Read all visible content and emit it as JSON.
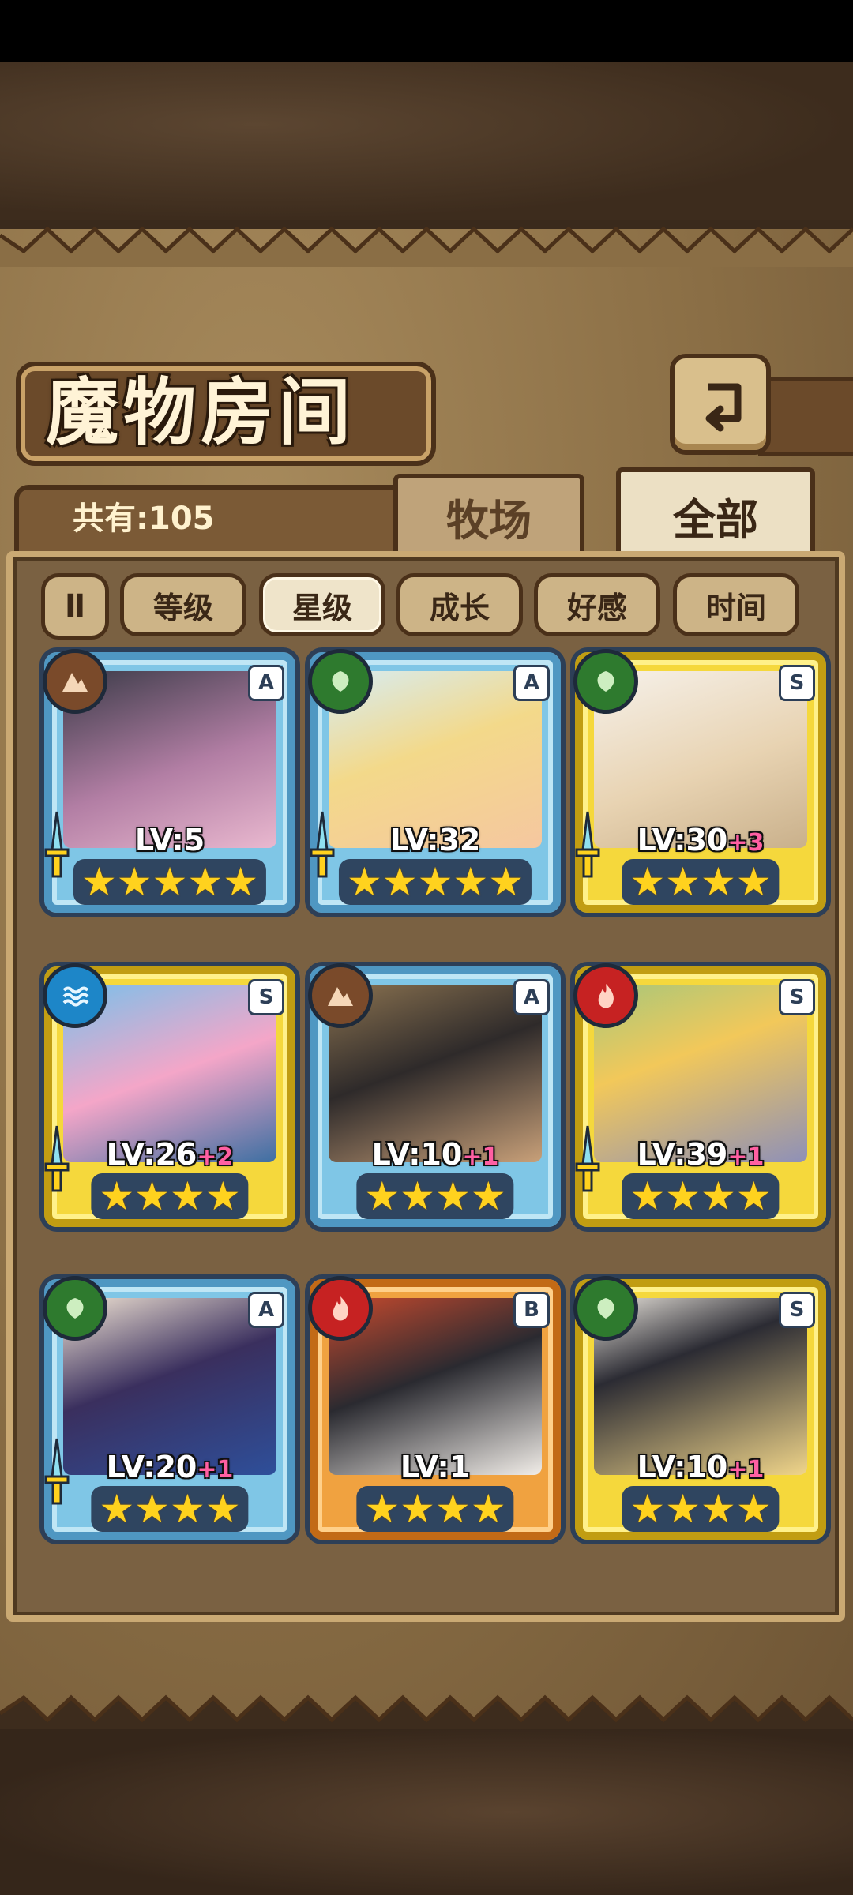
{
  "header": {
    "title": "魔物房间"
  },
  "collection": {
    "count_label": "共有:105"
  },
  "tabs": [
    {
      "label": "牧场"
    },
    {
      "label": "全部"
    }
  ],
  "filters": {
    "sort_toggle": "Ⅱ",
    "items": [
      {
        "label": "等级"
      },
      {
        "label": "星级"
      },
      {
        "label": "成长"
      },
      {
        "label": "好感"
      },
      {
        "label": "时间"
      }
    ],
    "active": "星级"
  },
  "cards": [
    {
      "rank": "A",
      "element": "earth",
      "level": "LV:5",
      "bonus": "",
      "stars": "★★★★★"
    },
    {
      "rank": "A",
      "element": "wood",
      "level": "LV:32",
      "bonus": "",
      "stars": "★★★★★"
    },
    {
      "rank": "S",
      "element": "wood",
      "level": "LV:30",
      "bonus": "+3",
      "stars": "★★★★"
    },
    {
      "rank": "S",
      "element": "water",
      "level": "LV:26",
      "bonus": "+2",
      "stars": "★★★★"
    },
    {
      "rank": "A",
      "element": "earth",
      "level": "LV:10",
      "bonus": "+1",
      "stars": "★★★★"
    },
    {
      "rank": "S",
      "element": "fire",
      "level": "LV:39",
      "bonus": "+1",
      "stars": "★★★★"
    },
    {
      "rank": "A",
      "element": "wood",
      "level": "LV:20",
      "bonus": "+1",
      "stars": "★★★★"
    },
    {
      "rank": "B",
      "element": "fire",
      "level": "LV:1",
      "bonus": "",
      "stars": "★★★★"
    },
    {
      "rank": "S",
      "element": "wood",
      "level": "LV:10",
      "bonus": "+1",
      "stars": "★★★★"
    }
  ]
}
